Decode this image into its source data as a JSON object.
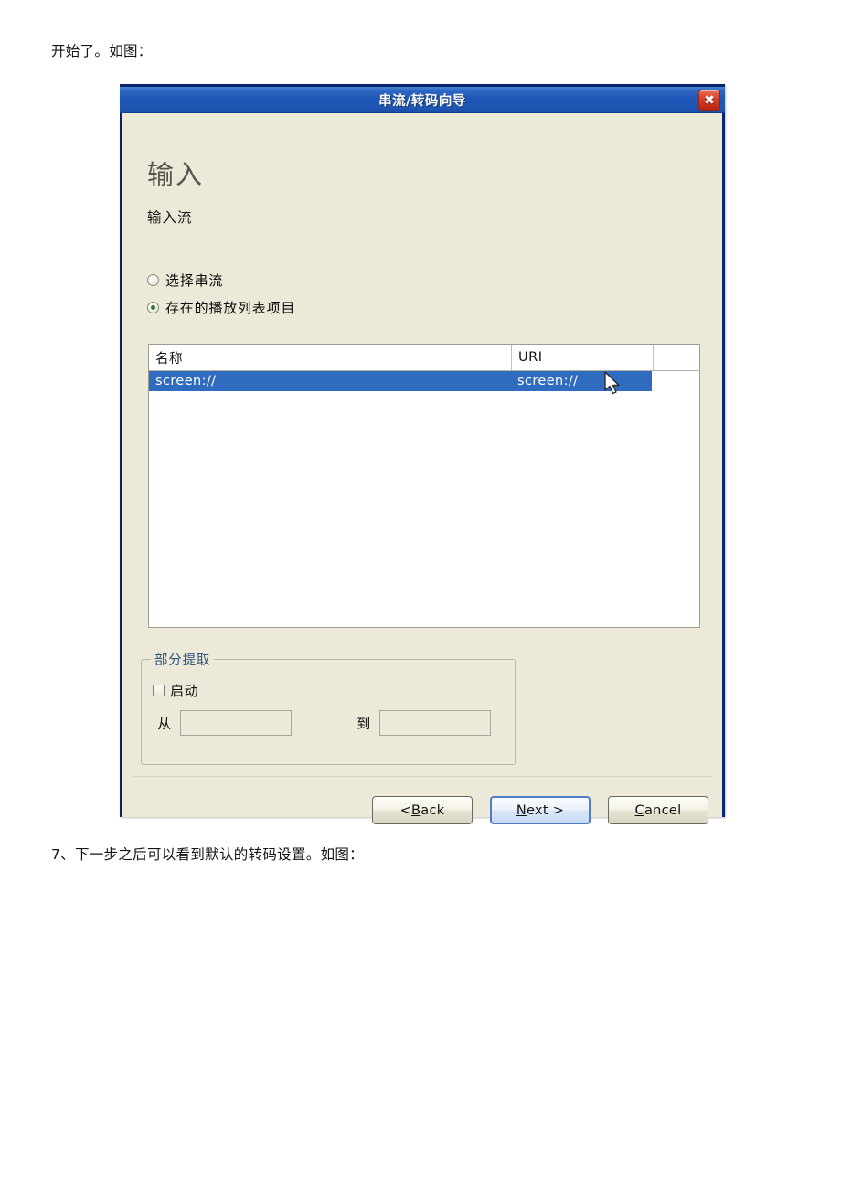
{
  "document": {
    "intro_line": "开始了。如图：",
    "outro_line": "7、下一步之后可以看到默认的转码设置。如图："
  },
  "dialog": {
    "title": "串流/转码向导",
    "close_icon": "close-icon",
    "heading": "输入",
    "subheading": "输入流",
    "accent_title_color": "#1d56b6",
    "selection_color": "#2f6cc0",
    "body_color": "#ece9d8",
    "source_options": [
      {
        "label": "选择串流",
        "selected": false
      },
      {
        "label": "存在的播放列表项目",
        "selected": true
      }
    ],
    "playlist": {
      "columns": [
        "名称",
        "URI",
        ""
      ],
      "rows": [
        {
          "name": "screen://",
          "uri": "screen://",
          "selected": true
        }
      ]
    },
    "partial_extract": {
      "legend": "部分提取",
      "legend_color": "#31557f",
      "enable_label": "启动",
      "enable_checked": false,
      "from_label": "从",
      "from_value": "",
      "to_label": "到",
      "to_value": ""
    },
    "buttons": {
      "back": {
        "prefix": "< ",
        "mnemonic": "B",
        "rest": "ack"
      },
      "next": {
        "prefix": "",
        "mnemonic": "N",
        "rest": "ext >"
      },
      "cancel": {
        "prefix": "",
        "mnemonic": "C",
        "rest": "ancel"
      }
    }
  }
}
